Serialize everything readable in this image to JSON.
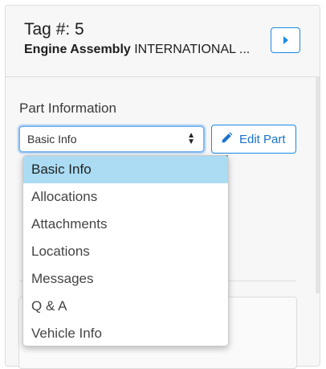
{
  "header": {
    "tag_label": "Tag #: 5",
    "subtitle_bold": "Engine Assembly",
    "subtitle_rest": " INTERNATIONAL ...",
    "next_icon": "caret-right-icon"
  },
  "part_info": {
    "section_label": "Part Information",
    "select_value": "Basic Info",
    "select_icon": "sort-caret-icon",
    "edit_label": "Edit Part",
    "edit_icon": "pencil-icon"
  },
  "dropdown": {
    "options": [
      {
        "label": "Basic Info",
        "selected": true
      },
      {
        "label": "Allocations",
        "selected": false
      },
      {
        "label": "Attachments",
        "selected": false
      },
      {
        "label": "Locations",
        "selected": false
      },
      {
        "label": "Messages",
        "selected": false
      },
      {
        "label": "Q & A",
        "selected": false
      },
      {
        "label": "Vehicle Info",
        "selected": false
      }
    ]
  },
  "colors": {
    "accent": "#1a8ae5",
    "selected_option": "#abdcf4"
  }
}
